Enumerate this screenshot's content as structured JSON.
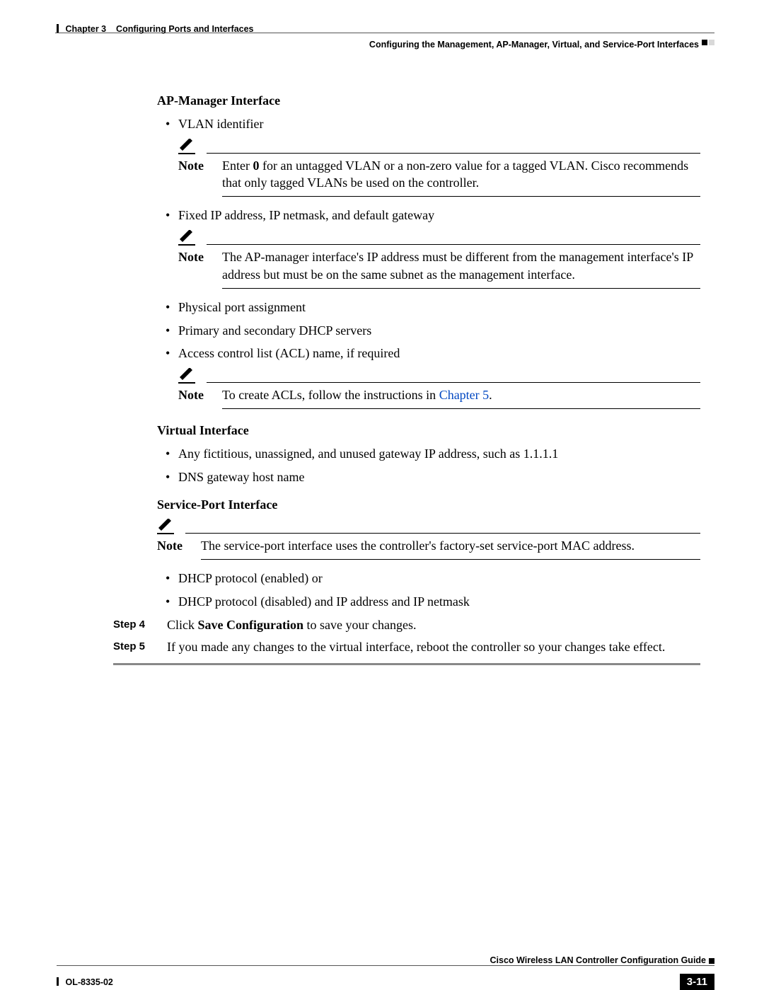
{
  "header": {
    "chapter_label": "Chapter 3",
    "chapter_title": "Configuring Ports and Interfaces",
    "section_title": "Configuring the Management, AP-Manager, Virtual, and Service-Port Interfaces"
  },
  "sections": {
    "ap_manager": {
      "heading": "AP-Manager Interface",
      "bullets": {
        "vlan": "VLAN identifier",
        "fixed_ip": "Fixed IP address, IP netmask, and default gateway",
        "phys_port": "Physical port assignment",
        "dhcp": "Primary and secondary DHCP servers",
        "acl": "Access control list (ACL) name, if required"
      },
      "notes": {
        "note_label": "Note",
        "vlan_note_pre": "Enter ",
        "vlan_note_bold": "0",
        "vlan_note_post": " for an untagged VLAN or a non-zero value for a tagged VLAN. Cisco recommends that only tagged VLANs be used on the controller.",
        "ip_note": "The AP-manager interface's IP address must be different from the management interface's IP address but must be on the same subnet as the management interface.",
        "acl_note_pre": "To create ACLs, follow the instructions in ",
        "acl_note_link": "Chapter 5",
        "acl_note_post": "."
      }
    },
    "virtual": {
      "heading": "Virtual Interface",
      "bullets": {
        "gw": "Any fictitious, unassigned, and unused gateway IP address, such as 1.1.1.1",
        "dns": "DNS gateway host name"
      }
    },
    "service_port": {
      "heading": "Service-Port Interface",
      "note_label": "Note",
      "note_text": "The service-port interface uses the controller's factory-set service-port MAC address.",
      "bullets": {
        "dhcp_en": "DHCP protocol (enabled) or",
        "dhcp_dis": "DHCP protocol (disabled) and IP address and IP netmask"
      }
    }
  },
  "steps": {
    "s4_label": "Step 4",
    "s4_pre": "Click ",
    "s4_bold": "Save Configuration",
    "s4_post": " to save your changes.",
    "s5_label": "Step 5",
    "s5_text": "If you made any changes to the virtual interface, reboot the controller so your changes take effect."
  },
  "footer": {
    "guide": "Cisco Wireless LAN Controller Configuration Guide",
    "doc_id": "OL-8335-02",
    "page": "3-11"
  }
}
